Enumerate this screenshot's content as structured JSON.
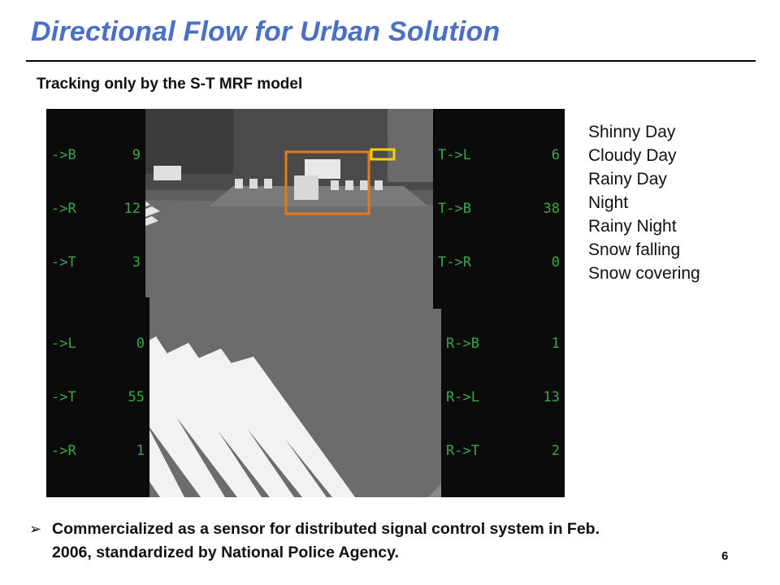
{
  "slide": {
    "title": "Directional Flow for Urban Solution",
    "subtitle": "Tracking only by the S-T MRF model",
    "page_number": "6"
  },
  "video": {
    "counters": {
      "top_left": [
        {
          "label": "->B",
          "value": "9"
        },
        {
          "label": "->R",
          "value": "12"
        },
        {
          "label": "->T",
          "value": "3"
        }
      ],
      "top_right": [
        {
          "label": "T->L",
          "value": "6"
        },
        {
          "label": "T->B",
          "value": "38"
        },
        {
          "label": "T->R",
          "value": "0"
        }
      ],
      "bottom_left": [
        {
          "label": "->L",
          "value": "0"
        },
        {
          "label": "->T",
          "value": "55"
        },
        {
          "label": "->R",
          "value": "1"
        }
      ],
      "bottom_right": [
        {
          "label": "R->B",
          "value": "1"
        },
        {
          "label": "R->L",
          "value": "13"
        },
        {
          "label": "R->T",
          "value": "2"
        }
      ]
    },
    "box_colors": {
      "tracking": "#e07a1c",
      "yellow": "#f2d200",
      "magenta": "#d020c8",
      "pink": "#e03070"
    }
  },
  "conditions": [
    "Shinny Day",
    "Cloudy Day",
    "Rainy Day",
    "Night",
    "Rainy Night",
    "Snow falling",
    "Snow covering"
  ],
  "bullet": {
    "marker": "➢",
    "line1": "Commercialized as a sensor for distributed signal control system in Feb.",
    "line2": "2006, standardized by National Police Agency."
  }
}
